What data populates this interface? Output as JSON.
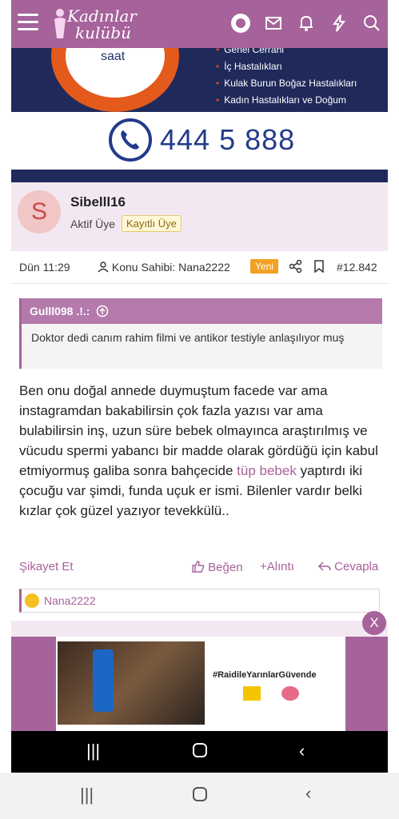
{
  "header": {
    "logo_line1": "Kadınlar",
    "logo_line2": "kulübü",
    "icons": [
      "menu-icon",
      "avatar-icon",
      "mail-icon",
      "bell-icon",
      "lightning-icon",
      "search-icon"
    ]
  },
  "ad_top": {
    "saat": "saat",
    "items": [
      "Genel Cerrahi",
      "İç Hastalıkları",
      "Kulak Burun Boğaz Hastalıkları",
      "Kadın Hastalıkları ve Doğum"
    ],
    "phone": "444 5 888"
  },
  "post": {
    "avatar_letter": "S",
    "username": "Sibelll16",
    "role": "Aktif Üye",
    "badge": "Kayıtlı Üye",
    "time": "Dün 11:29",
    "thread_owner": "Konu Sahibi: Nana2222",
    "new_label": "Yeni",
    "post_number": "#12.842",
    "quote": {
      "author": "Gulll098 .!.:",
      "text": "Doktor dedi canım rahim filmi ve antikor testiyle anlaşılıyor muş"
    },
    "content_before": "Ben onu doğal annede duymuştum facede var ama instagramdan bakabilirsin çok fazla yazısı var ama bulabilirsin inş, uzun süre bebek olmayınca araştırılmış ve vücudu spermi yabancı bir madde olarak gördüğü için kabul etmiyormuş galiba sonra bahçecide ",
    "content_link": "tüp bebek",
    "content_after": " yaptırdı iki çocuğu var şimdi, funda uçuk er ismi. Bilenler vardır belki kızlar çok güzel yazıyor tevekkülü..",
    "actions": {
      "report": "Şikayet Et",
      "like": "Beğen",
      "quote": "Alıntı",
      "reply": "Cevapla"
    },
    "reaction_user": "Nana2222"
  },
  "ad_bottom": {
    "close": "X",
    "hashtag": "#RaidileYarınlarGüvende"
  },
  "colors": {
    "brand": "#a6629a",
    "ad_navy": "#1f2a5a",
    "phone_blue": "#243a8a",
    "new_badge": "#f1a021"
  }
}
